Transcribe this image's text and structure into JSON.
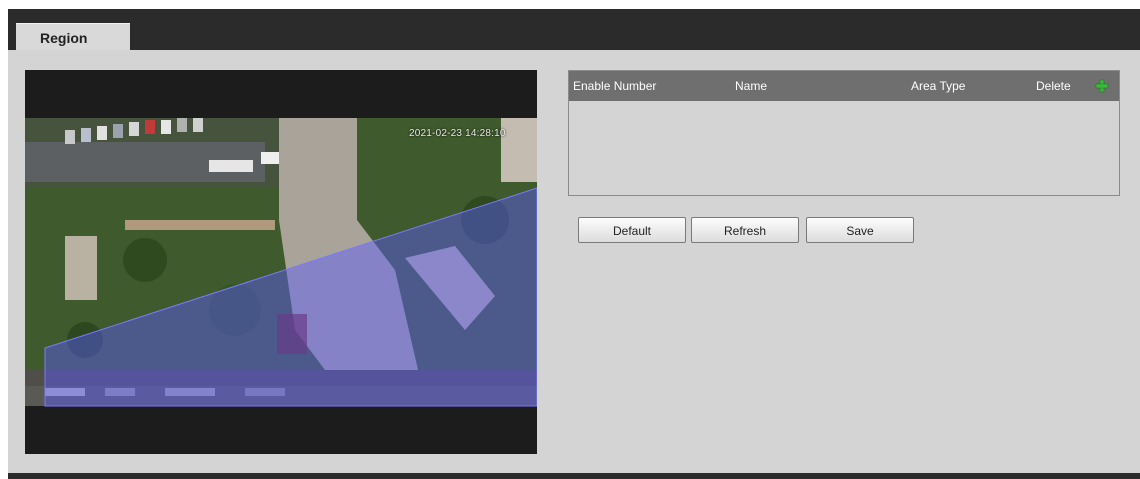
{
  "tabs": [
    {
      "label": "Region",
      "active": true
    }
  ],
  "video": {
    "timestamp": "2021-02-23 14:28:10"
  },
  "table": {
    "columns": [
      "Enable Number",
      "Name",
      "Area Type",
      "Delete"
    ],
    "add_icon": "plus-icon",
    "rows": []
  },
  "buttons": {
    "default_label": "Default",
    "refresh_label": "Refresh",
    "save_label": "Save"
  },
  "colors": {
    "header": "#6f6f6f",
    "panel": "#d4d4d4",
    "topbar": "#2b2b2b",
    "add_icon": "#3cb83c",
    "region_overlay": "#5a5aff"
  }
}
